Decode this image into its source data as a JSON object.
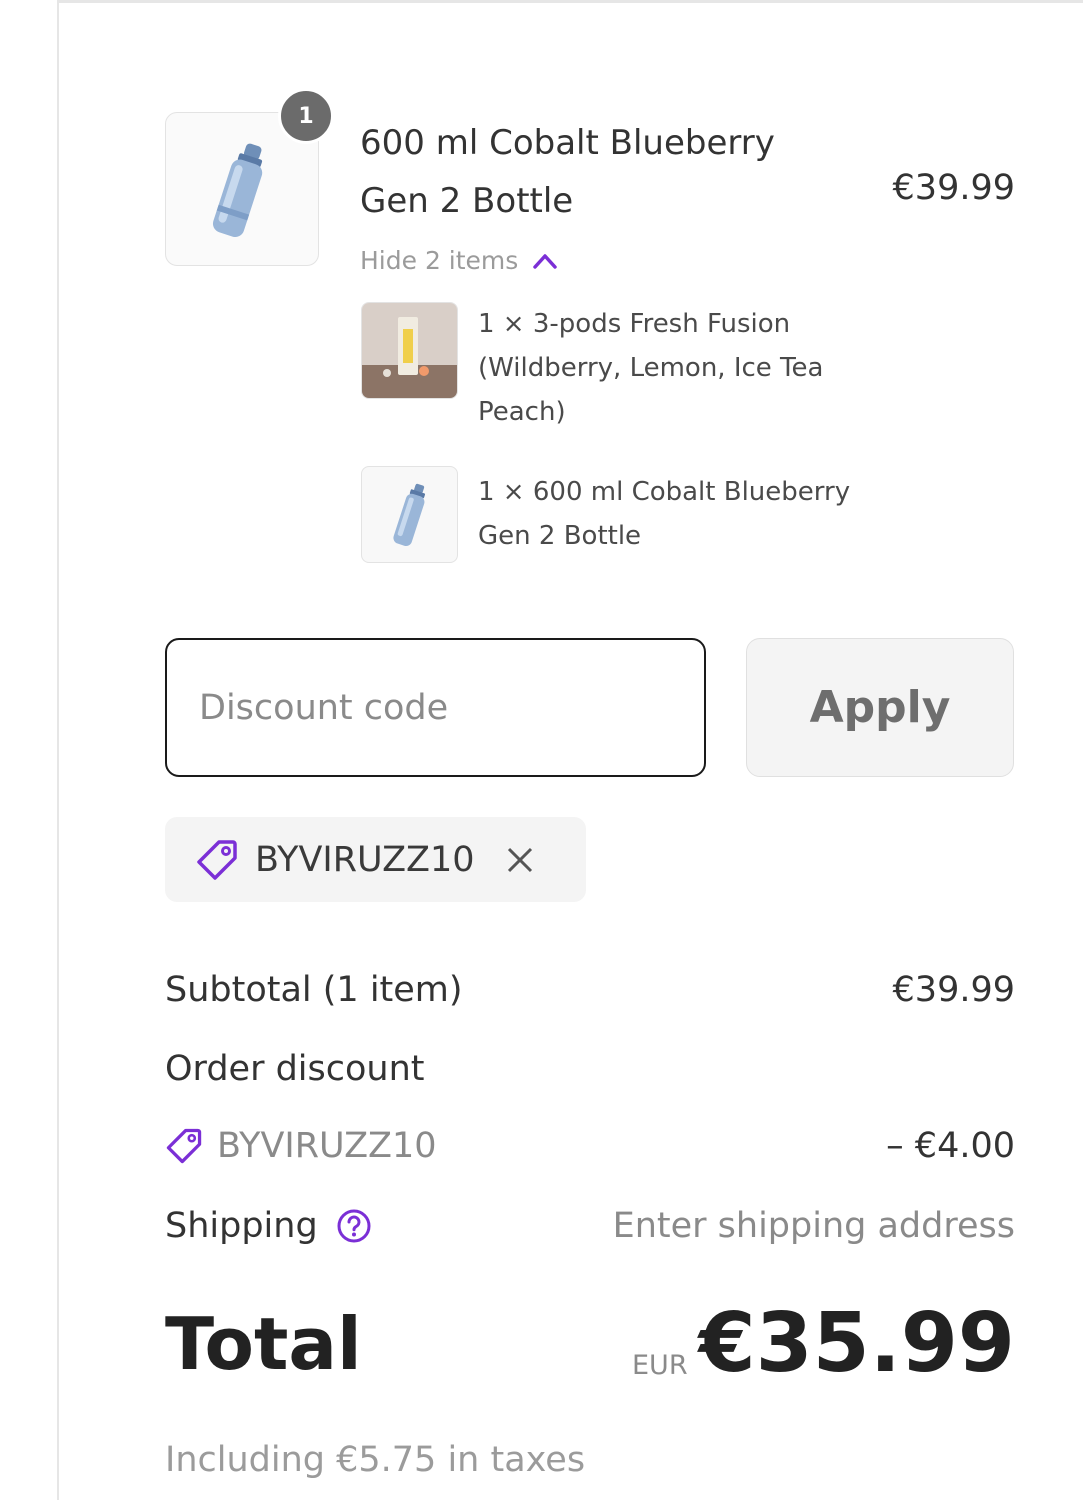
{
  "product": {
    "title": "600 ml Cobalt Blueberry Gen 2 Bottle",
    "price": "€39.99",
    "quantity_badge": "1",
    "image_icon": "water-bottle-icon",
    "bundle_toggle_label": "Hide 2 items",
    "bundle_items": [
      {
        "text": "1 × 3-pods Fresh Fusion (Wildberry, Lemon, Ice Tea Peach)",
        "image_icon": "flavor-pods-icon"
      },
      {
        "text": "1 × 600 ml Cobalt Blueberry Gen 2 Bottle",
        "image_icon": "water-bottle-icon"
      }
    ]
  },
  "discount": {
    "placeholder": "Discount code",
    "apply_label": "Apply",
    "applied_code": "BYVIRUZZ10"
  },
  "summary": {
    "subtotal_label": "Subtotal (1 item)",
    "subtotal_value": "€39.99",
    "order_discount_label": "Order discount",
    "discount_code": "BYVIRUZZ10",
    "discount_value": "– €4.00",
    "shipping_label": "Shipping",
    "shipping_value": "Enter shipping address",
    "total_label": "Total",
    "currency": "EUR",
    "total_value": "€35.99",
    "tax_note": "Including €5.75 in taxes"
  },
  "colors": {
    "accent": "#7b2fd6",
    "text": "#333333",
    "muted": "#8a8a8a"
  }
}
